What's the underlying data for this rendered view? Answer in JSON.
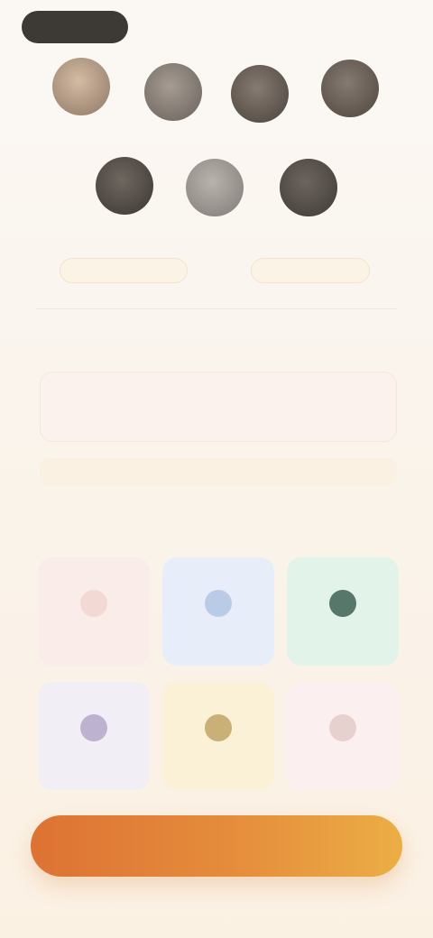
{
  "header": {
    "back_label": "",
    "right_link": ""
  },
  "avatars": [
    {
      "name": "avatar-1"
    },
    {
      "name": "avatar-2"
    },
    {
      "name": "avatar-3"
    },
    {
      "name": "avatar-4"
    },
    {
      "name": "avatar-5"
    },
    {
      "name": "avatar-6"
    },
    {
      "name": "avatar-7"
    }
  ],
  "chips": {
    "left": "",
    "right": ""
  },
  "section": {
    "label": "",
    "card_title": "",
    "card_sub": "",
    "note": ""
  },
  "quick": {
    "label": "",
    "tiles": [
      {
        "label": "",
        "color": "#f9ece9"
      },
      {
        "label": "",
        "color": "#e7eefa"
      },
      {
        "label": "",
        "color": "#e2f4e9"
      },
      {
        "label": "",
        "color": "#f2eef6"
      },
      {
        "label": "",
        "color": "#fbf1d7"
      },
      {
        "label": "",
        "color": "#fbf0ef"
      }
    ]
  },
  "cta": {
    "label": "",
    "gradient_start": "#dd7233",
    "gradient_end": "#ebae45"
  }
}
